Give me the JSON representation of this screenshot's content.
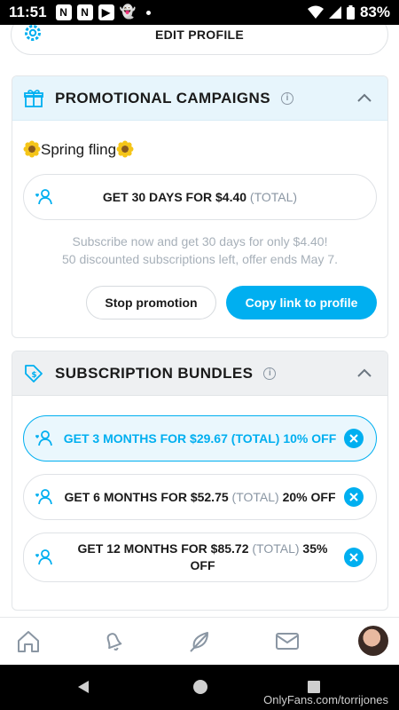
{
  "status_bar": {
    "time": "11:51",
    "battery": "83%",
    "notification_icons": [
      "news-icon",
      "news-icon",
      "youtube-icon",
      "snapchat-icon"
    ]
  },
  "edit_profile": {
    "label": "EDIT PROFILE"
  },
  "promotional_campaigns": {
    "title": "PROMOTIONAL CAMPAIGNS",
    "campaign_name": "Spring fling",
    "offer_main": "GET 30 DAYS FOR $4.40",
    "offer_suffix": "(TOTAL)",
    "description_line1": "Subscribe now and get 30 days for only $4.40!",
    "description_line2": "50 discounted subscriptions left, offer ends May 7.",
    "stop_button": "Stop promotion",
    "copy_button": "Copy link to profile"
  },
  "subscription_bundles": {
    "title": "SUBSCRIPTION BUNDLES",
    "bundles": [
      {
        "main": "GET 3 MONTHS FOR $29.67",
        "total": "(TOTAL)",
        "discount": "10% OFF",
        "active": true
      },
      {
        "main": "GET 6 MONTHS FOR $52.75",
        "total": "(TOTAL)",
        "discount": "20% OFF",
        "active": false
      },
      {
        "main": "GET 12 MONTHS FOR $85.72",
        "total": "(TOTAL)",
        "discount": "35% OFF",
        "active": false
      }
    ]
  },
  "bottom_nav": [
    "home-icon",
    "bell-icon",
    "feather-icon",
    "messages-icon",
    "avatar"
  ],
  "watermark": "OnlyFans.com/torrijones",
  "colors": {
    "accent": "#00aff0",
    "muted": "#8a96a3"
  }
}
